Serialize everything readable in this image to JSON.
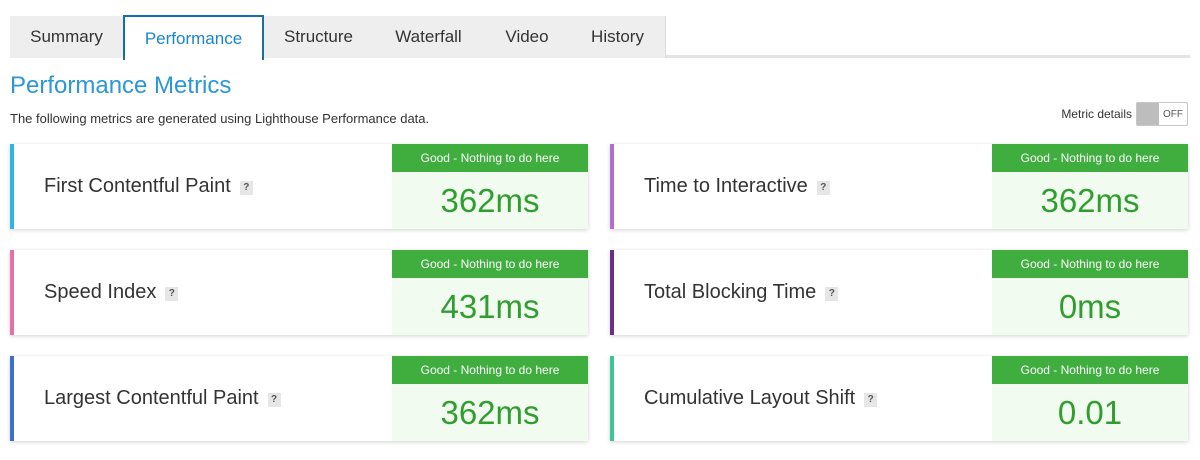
{
  "tabs": [
    {
      "label": "Summary"
    },
    {
      "label": "Performance"
    },
    {
      "label": "Structure"
    },
    {
      "label": "Waterfall"
    },
    {
      "label": "Video"
    },
    {
      "label": "History"
    }
  ],
  "active_tab": "Performance",
  "heading": {
    "title": "Performance Metrics",
    "subtitle": "The following metrics are generated using Lighthouse Performance data."
  },
  "metric_details": {
    "label": "Metric details",
    "state": "OFF"
  },
  "metrics": [
    {
      "name": "First Contentful Paint",
      "help": "?",
      "badge": "Good - Nothing to do here",
      "value": "362ms",
      "color": "#2fb4e6"
    },
    {
      "name": "Time to Interactive",
      "help": "?",
      "badge": "Good - Nothing to do here",
      "value": "362ms",
      "color": "#b06fce"
    },
    {
      "name": "Speed Index",
      "help": "?",
      "badge": "Good - Nothing to do here",
      "value": "431ms",
      "color": "#e86fa6"
    },
    {
      "name": "Total Blocking Time",
      "help": "?",
      "badge": "Good - Nothing to do here",
      "value": "0ms",
      "color": "#6a2f86"
    },
    {
      "name": "Largest Contentful Paint",
      "help": "?",
      "badge": "Good - Nothing to do here",
      "value": "362ms",
      "color": "#3b6fd0"
    },
    {
      "name": "Cumulative Layout Shift",
      "help": "?",
      "badge": "Good - Nothing to do here",
      "value": "0.01",
      "color": "#3fc49a"
    }
  ],
  "colors": {
    "accent": "#2a97d8",
    "good_badge": "#3fae3f",
    "good_value": "#2f9e2f",
    "good_bg": "#f1fbef"
  }
}
